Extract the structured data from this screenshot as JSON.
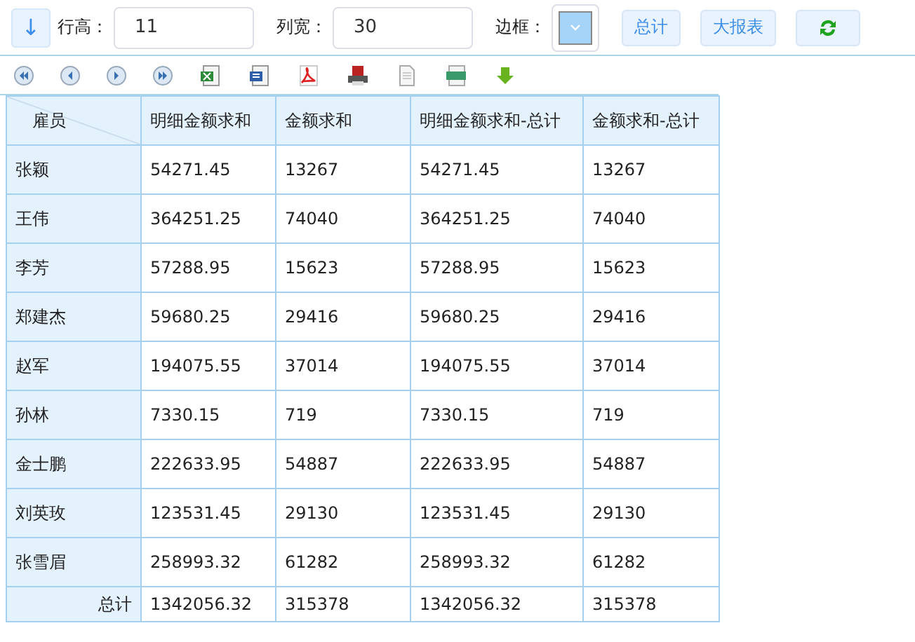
{
  "toolbar": {
    "sort_button": "↓",
    "row_height": {
      "label": "行高：",
      "value": "11"
    },
    "column_width": {
      "label": "列宽：",
      "value": "30"
    },
    "border": {
      "label": "边框："
    },
    "buttons": [
      "总计",
      "大报表"
    ]
  },
  "table": {
    "corner": "雇员",
    "columns": [
      "明细金额求和",
      "金额求和",
      "明细金额求和-总计",
      "金额求和-总计"
    ],
    "rows": [
      {
        "name": "张颖",
        "cells": [
          "54271.45",
          "13267",
          "54271.45",
          "13267"
        ]
      },
      {
        "name": "王伟",
        "cells": [
          "364251.25",
          "74040",
          "364251.25",
          "74040"
        ]
      },
      {
        "name": "李芳",
        "cells": [
          "57288.95",
          "15623",
          "57288.95",
          "15623"
        ]
      },
      {
        "name": "郑建杰",
        "cells": [
          "59680.25",
          "29416",
          "59680.25",
          "29416"
        ]
      },
      {
        "name": "赵军",
        "cells": [
          "194075.55",
          "37014",
          "194075.55",
          "37014"
        ]
      },
      {
        "name": "孙林",
        "cells": [
          "7330.15",
          "719",
          "7330.15",
          "719"
        ]
      },
      {
        "name": "金士鹏",
        "cells": [
          "222633.95",
          "54887",
          "222633.95",
          "54887"
        ]
      },
      {
        "name": "刘英玫",
        "cells": [
          "123531.45",
          "29130",
          "123531.45",
          "29130"
        ]
      },
      {
        "name": "张雪眉",
        "cells": [
          "258993.32",
          "61282",
          "258993.32",
          "61282"
        ]
      }
    ],
    "total": {
      "label": "总计",
      "cells": [
        "1342056.32",
        "315378",
        "1342056.32",
        "315378"
      ]
    }
  }
}
